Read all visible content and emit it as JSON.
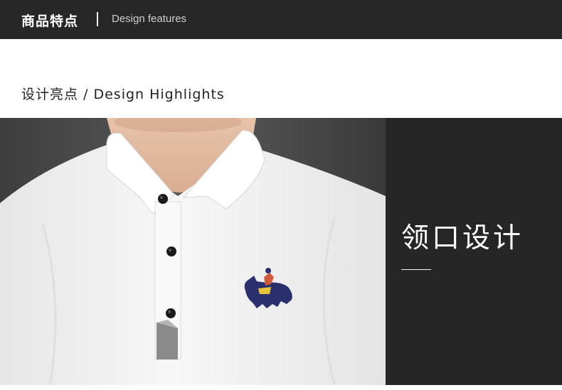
{
  "header": {
    "title_zh": "商品特点",
    "title_en": "Design features"
  },
  "section": {
    "subtitle": "设计亮点 / Design Highlights"
  },
  "feature": {
    "title": "领口设计",
    "image_description_icon": "polo-shirt-collar-photo",
    "logo_icon": "horse-rider-embroidery-icon"
  },
  "colors": {
    "header_bg": "#272727",
    "panel_bg": "#262626",
    "shirt": "#f4f4f4",
    "accent_gray": "#8a8a8a"
  }
}
